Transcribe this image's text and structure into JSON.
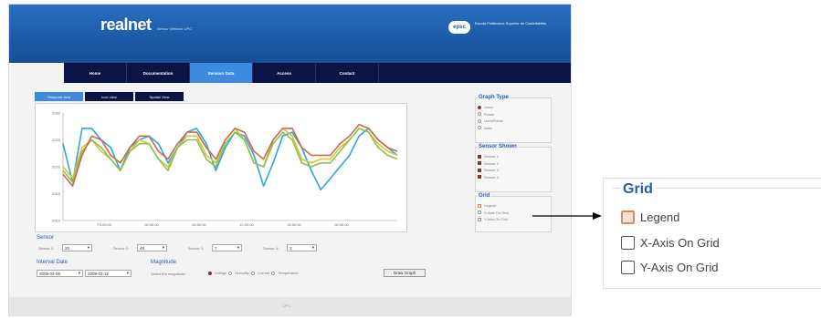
{
  "header": {
    "brand": "realnet",
    "brand_sub": "Sensor Network UPC",
    "logo": "epsc",
    "school": "Escola Politècnica Superior de Castelldefels"
  },
  "nav": {
    "items": [
      "Home",
      "Documentation",
      "Sensors Data",
      "Access",
      "Contact"
    ],
    "active": 2
  },
  "view_tabs": {
    "items": [
      "Temporal view",
      "Icon view",
      "Spatial View"
    ],
    "active": 0
  },
  "chart_data": {
    "type": "line",
    "ytick_labels": [
      "2010",
      "2015",
      "2020",
      "2025",
      "2030"
    ],
    "xtick_labels": [
      "TS:00:00",
      "00:00:00",
      "06:00:00",
      "12:00:00",
      "18:00:00",
      "00:00:00"
    ],
    "ylim": [
      2005,
      2033
    ],
    "x": [
      0,
      2,
      4,
      6,
      8,
      10,
      12,
      14,
      16,
      18,
      20,
      22,
      24,
      26,
      28,
      30,
      32,
      34,
      36,
      38,
      40,
      42,
      44,
      46,
      48,
      50,
      52,
      54,
      56,
      58,
      60,
      62,
      64,
      66,
      68,
      70
    ],
    "series": [
      {
        "color": "#2ea5dc",
        "values": [
          2025,
          2015,
          2029,
          2029,
          2026,
          2024,
          2018,
          2024,
          2026,
          2027,
          2025,
          2020,
          2024,
          2028,
          2029,
          2025,
          2018,
          2024,
          2028,
          2027,
          2022,
          2014,
          2020,
          2027,
          2028,
          2024,
          2018,
          2013,
          2016,
          2019,
          2022,
          2027,
          2029,
          2026,
          2024,
          2022
        ]
      },
      {
        "color": "#d8c43a",
        "values": [
          2019,
          2016,
          2024,
          2026,
          2023,
          2021,
          2018,
          2023,
          2026,
          2025,
          2021,
          2019,
          2024,
          2027,
          2027,
          2022,
          2020,
          2026,
          2029,
          2026,
          2020,
          2019,
          2026,
          2029,
          2027,
          2021,
          2020,
          2021,
          2021,
          2024,
          2026,
          2029,
          2028,
          2025,
          2023,
          2022
        ]
      },
      {
        "color": "#8fbf4a",
        "values": [
          2018,
          2015,
          2023,
          2026,
          2024,
          2021,
          2018,
          2023,
          2025,
          2025,
          2021,
          2018,
          2024,
          2026,
          2026,
          2021,
          2019,
          2025,
          2028,
          2026,
          2020,
          2019,
          2025,
          2028,
          2026,
          2020,
          2019,
          2020,
          2020,
          2023,
          2026,
          2029,
          2028,
          2024,
          2022,
          2021
        ]
      },
      {
        "color": "#c76a4e",
        "values": [
          2017,
          2014,
          2022,
          2027,
          2026,
          2022,
          2020,
          2024,
          2027,
          2027,
          2023,
          2021,
          2025,
          2028,
          2028,
          2024,
          2021,
          2026,
          2029,
          2028,
          2023,
          2021,
          2026,
          2029,
          2029,
          2024,
          2022,
          2022,
          2022,
          2025,
          2027,
          2030,
          2029,
          2026,
          2024,
          2023
        ]
      }
    ]
  },
  "graph_type": {
    "title": "Graph Type",
    "options": [
      "Lines",
      "Points",
      "LinesPoints",
      "Area"
    ],
    "selected": 0
  },
  "sensor_shown": {
    "title": "Sensor Shown",
    "items": [
      "Sensor 1",
      "Sensor 2",
      "Sensor 3",
      "Sensor 4"
    ]
  },
  "grid": {
    "title": "Grid",
    "items": [
      "Legend",
      "X-Axis On Grid",
      "Y-Axis On Grid"
    ]
  },
  "sensor_select": {
    "label": "Sensor",
    "items": [
      {
        "label": "Sensor 1:",
        "value": "20"
      },
      {
        "label": "Sensor 2:",
        "value": "48"
      },
      {
        "label": "Sensor 3:",
        "value": "7"
      },
      {
        "label": "Sensor 4:",
        "value": "3"
      }
    ]
  },
  "interval": {
    "label": "Interval Date",
    "from": "2009-03-06",
    "to": "2009-03-12"
  },
  "magnitude": {
    "label": "Magnitude",
    "prompt": "Select the magnitude:",
    "options": [
      "Voltage",
      "Humidity",
      "Current",
      "Temperature"
    ],
    "selected": 0
  },
  "draw_button": "Draw Graph",
  "footer": "UPC",
  "zoom": {
    "title": "Grid",
    "items": [
      "Legend",
      "X-Axis On Grid",
      "Y-Axis On Grid"
    ]
  }
}
